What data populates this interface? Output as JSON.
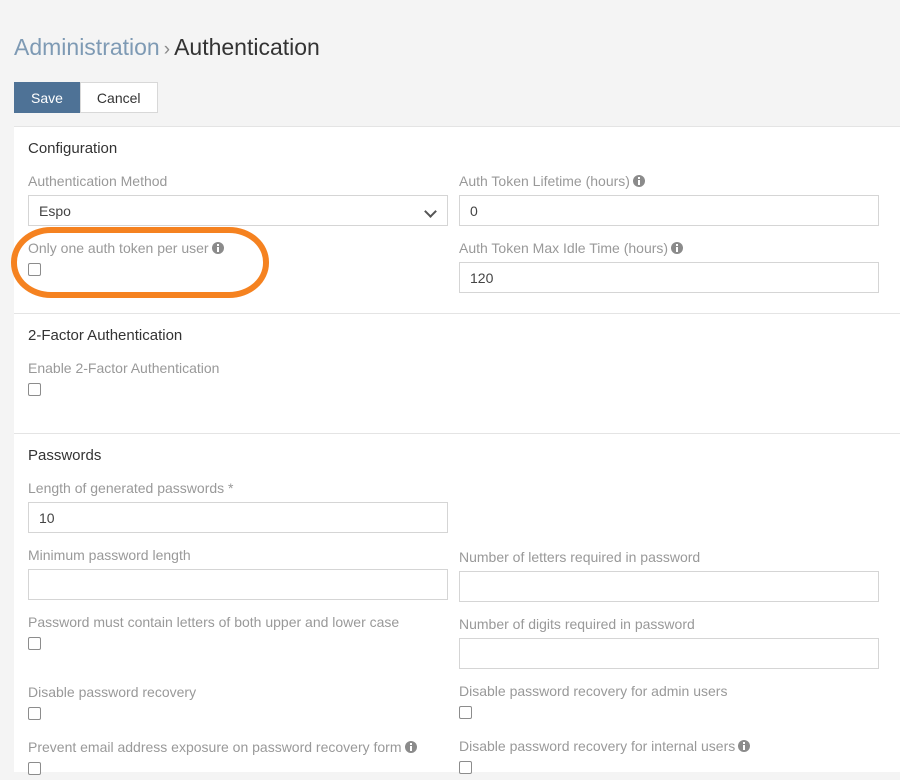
{
  "breadcrumb": {
    "parent": "Administration",
    "separator": "›",
    "current": "Authentication"
  },
  "toolbar": {
    "save_label": "Save",
    "cancel_label": "Cancel"
  },
  "icons": {
    "info": "info-icon",
    "chevron_down": "chevron-down-icon"
  },
  "annotation": {
    "color": "#f58220",
    "target": "Only one auth token per user"
  },
  "sections": [
    {
      "title": "Configuration",
      "fields": [
        {
          "label": "Authentication Method",
          "type": "select",
          "value": "Espo",
          "has_info": false
        },
        {
          "label": "Auth Token Lifetime (hours)",
          "type": "text",
          "value": "0",
          "has_info": true
        },
        {
          "label": "Only one auth token per user",
          "type": "checkbox",
          "value": "",
          "has_info": true
        },
        {
          "label": "Auth Token Max Idle Time (hours)",
          "type": "text",
          "value": "120",
          "has_info": true
        }
      ]
    },
    {
      "title": "2-Factor Authentication",
      "fields": [
        {
          "label": "Enable 2-Factor Authentication",
          "type": "checkbox",
          "value": "",
          "has_info": false
        }
      ]
    },
    {
      "title": "Passwords",
      "fields": [
        {
          "label": "Length of generated passwords *",
          "type": "text",
          "value": "10",
          "has_info": false
        },
        {
          "label": "Minimum password length",
          "type": "text",
          "value": "",
          "has_info": false
        },
        {
          "label": "Number of letters required in password",
          "type": "text",
          "value": "",
          "has_info": false
        },
        {
          "label": "Password must contain letters of both upper and lower case",
          "type": "checkbox",
          "value": "",
          "has_info": false
        },
        {
          "label": "Number of digits required in password",
          "type": "text",
          "value": "",
          "has_info": false
        },
        {
          "label": "Disable password recovery",
          "type": "checkbox",
          "value": "",
          "has_info": false
        },
        {
          "label": "Disable password recovery for admin users",
          "type": "checkbox",
          "value": "",
          "has_info": false
        },
        {
          "label": "Prevent email address exposure on password recovery form",
          "type": "checkbox",
          "value": "",
          "has_info": true
        },
        {
          "label": "Disable password recovery for internal users",
          "type": "checkbox",
          "value": "",
          "has_info": true
        }
      ]
    }
  ]
}
